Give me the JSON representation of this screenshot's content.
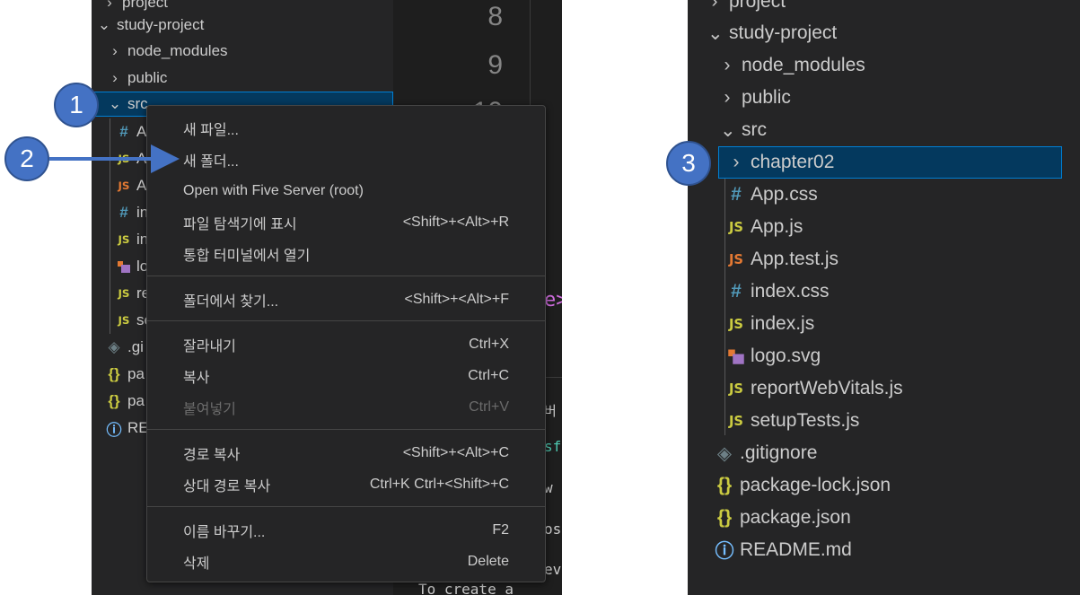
{
  "left_tree": {
    "rows": [
      {
        "chev": "›",
        "icon": "",
        "label": "project"
      },
      {
        "chev": "⌄",
        "icon": "",
        "label": "study-project"
      },
      {
        "chev": "›",
        "icon": "",
        "label": "node_modules"
      },
      {
        "chev": "›",
        "icon": "",
        "label": "public"
      },
      {
        "chev": "⌄",
        "icon": "",
        "label": "src"
      }
    ],
    "children": [
      {
        "icon": "#",
        "label": "A"
      },
      {
        "icon": "JS",
        "label": "A"
      },
      {
        "icon": "JS",
        "label": "A"
      },
      {
        "icon": "#",
        "label": "in"
      },
      {
        "icon": "JS",
        "label": "in"
      },
      {
        "icon": "svg",
        "label": "lo"
      },
      {
        "icon": "JS",
        "label": "re"
      },
      {
        "icon": "JS",
        "label": "se"
      }
    ],
    "root_files": [
      {
        "icon": "◈",
        "label": ".gi"
      },
      {
        "icon": "{}",
        "label": "pa"
      },
      {
        "icon": "{}",
        "label": "pa"
      },
      {
        "icon": "ⓘ",
        "label": "RE"
      }
    ]
  },
  "editor": {
    "line_numbers": [
      "8",
      "9",
      "10"
    ],
    "fragments": [
      "e>",
      "버",
      "sf",
      "w",
      "os",
      "ev"
    ],
    "terminal_text": "To create a produ"
  },
  "context_menu": {
    "groups": [
      [
        {
          "label": "새 파일...",
          "key": ""
        },
        {
          "label": "새 폴더...",
          "key": ""
        },
        {
          "label": "Open with Five Server (root)",
          "key": ""
        },
        {
          "label": "파일 탐색기에 표시",
          "key": "<Shift>+<Alt>+R"
        },
        {
          "label": "통합 터미널에서 열기",
          "key": ""
        }
      ],
      [
        {
          "label": "폴더에서 찾기...",
          "key": "<Shift>+<Alt>+F"
        }
      ],
      [
        {
          "label": "잘라내기",
          "key": "Ctrl+X"
        },
        {
          "label": "복사",
          "key": "Ctrl+C"
        },
        {
          "label": "붙여넣기",
          "key": "Ctrl+V",
          "disabled": true
        }
      ],
      [
        {
          "label": "경로 복사",
          "key": "<Shift>+<Alt>+C"
        },
        {
          "label": "상대 경로 복사",
          "key": "Ctrl+K Ctrl+<Shift>+C"
        }
      ],
      [
        {
          "label": "이름 바꾸기...",
          "key": "F2"
        },
        {
          "label": "삭제",
          "key": "Delete"
        }
      ]
    ]
  },
  "right_tree": {
    "rows": [
      {
        "chev": "›",
        "label": "project"
      },
      {
        "chev": "⌄",
        "label": "study-project"
      },
      {
        "chev": "›",
        "label": "node_modules"
      },
      {
        "chev": "›",
        "label": "public"
      },
      {
        "chev": "⌄",
        "label": "src"
      },
      {
        "chev": "›",
        "label": "chapter02"
      }
    ],
    "children": [
      {
        "icon": "#",
        "label": "App.css"
      },
      {
        "icon": "JS",
        "label": "App.js"
      },
      {
        "icon": "JS",
        "label": "App.test.js"
      },
      {
        "icon": "#",
        "label": "index.css"
      },
      {
        "icon": "JS",
        "label": "index.js"
      },
      {
        "icon": "svg",
        "label": "logo.svg"
      },
      {
        "icon": "JS",
        "label": "reportWebVitals.js"
      },
      {
        "icon": "JS",
        "label": "setupTests.js"
      }
    ],
    "root_files": [
      {
        "icon": "◈",
        "label": ".gitignore"
      },
      {
        "icon": "{}",
        "label": "package-lock.json"
      },
      {
        "icon": "{}",
        "label": "package.json"
      },
      {
        "icon": "ⓘ",
        "label": "README.md"
      }
    ]
  },
  "badges": [
    "1",
    "2",
    "3"
  ],
  "colors": {
    "sidebar_bg": "#252526",
    "editor_bg": "#1e1e1e",
    "selection": "#04395e",
    "focus_border": "#007fd4",
    "badge": "#4472c4"
  }
}
